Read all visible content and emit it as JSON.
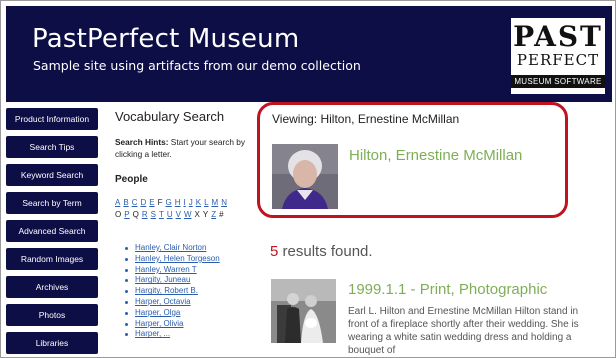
{
  "header": {
    "title": "PastPerfect Museum",
    "subtitle": "Sample site using artifacts from our demo collection",
    "logo": {
      "line1": "PAST",
      "line2": "PERFECT",
      "line3": "MUSEUM SOFTWARE"
    },
    "background_color": "#0e0e47"
  },
  "nav": {
    "items": [
      "Product Information",
      "Search Tips",
      "Keyword Search",
      "Search by Term",
      "Advanced Search",
      "Random Images",
      "Archives",
      "Photos",
      "Libraries"
    ]
  },
  "vocabulary": {
    "title": "Vocabulary Search",
    "hints_label": "Search Hints:",
    "hints_text": " Start your search by clicking a letter.",
    "section": "People",
    "letters": [
      "A",
      "B",
      "C",
      "D",
      "E",
      "F",
      "G",
      "H",
      "I",
      "J",
      "K",
      "L",
      "M",
      "N",
      "O",
      "P",
      "Q",
      "R",
      "S",
      "T",
      "U",
      "V",
      "W",
      "X",
      "Y",
      "Z",
      "#"
    ],
    "current_letter": "H",
    "unlinked_letters": [
      "F",
      "O",
      "Q",
      "X",
      "Y",
      "#"
    ],
    "names": [
      "Hanley, Clair Norton",
      "Hanley, Helen Torgeson",
      "Hanley, Warren T",
      "Hargity, Juneau",
      "Hargity, Robert B.",
      "Harper, Octavia",
      "Harper, Olga",
      "Harper, Olivia",
      "Harper, ..."
    ]
  },
  "viewing": {
    "label": "Viewing: Hilton, Ernestine McMillan",
    "name": "Hilton, Ernestine McMillan",
    "highlight_color": "#c0121f"
  },
  "results": {
    "count": "5",
    "text": " results found.",
    "items": [
      {
        "title": "1999.1.1 - Print, Photographic",
        "description": "Earl L. Hilton and Ernestine McMillan Hilton stand in front of a fireplace shortly after their wedding. She is wearing a white satin wedding dress and holding a bouquet of"
      }
    ]
  },
  "colors": {
    "link": "#2a5db0",
    "accent_green": "#7fae57"
  }
}
